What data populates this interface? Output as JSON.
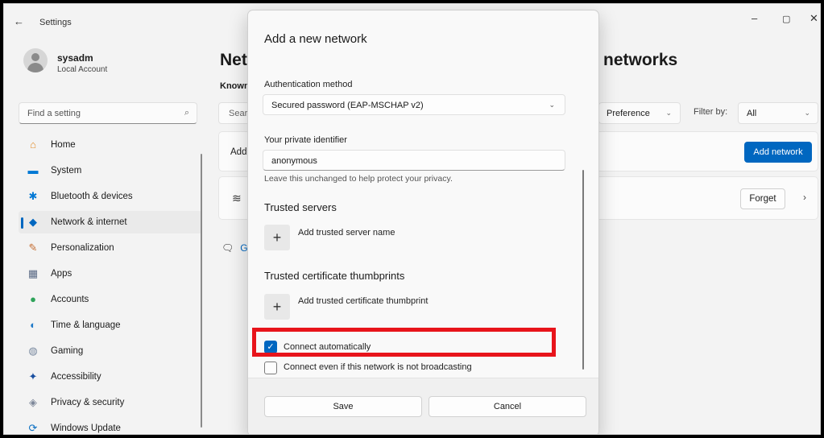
{
  "window": {
    "back": "←",
    "title": "Settings",
    "minimize": "–",
    "maximize": "▢",
    "close": "✕"
  },
  "profile": {
    "name": "sysadm",
    "type": "Local Account"
  },
  "sidebar": {
    "search_placeholder": "Find a setting",
    "items": [
      {
        "label": "Home",
        "icon": "⌂",
        "color": "#e28d2b"
      },
      {
        "label": "System",
        "icon": "▬",
        "color": "#0078d4"
      },
      {
        "label": "Bluetooth & devices",
        "icon": "✱",
        "color": "#0078d4"
      },
      {
        "label": "Network & internet",
        "icon": "◆",
        "color": "#0067c0",
        "active": true
      },
      {
        "label": "Personalization",
        "icon": "✎",
        "color": "#c36a2d"
      },
      {
        "label": "Apps",
        "icon": "▦",
        "color": "#5a6a85"
      },
      {
        "label": "Accounts",
        "icon": "●",
        "color": "#2ea35a"
      },
      {
        "label": "Time & language",
        "icon": "◐",
        "color": "#1f7ac8"
      },
      {
        "label": "Gaming",
        "icon": "◍",
        "color": "#7a8aa0"
      },
      {
        "label": "Accessibility",
        "icon": "✦",
        "color": "#1a4fa0"
      },
      {
        "label": "Privacy & security",
        "icon": "◈",
        "color": "#7d8799"
      },
      {
        "label": "Windows Update",
        "icon": "⟳",
        "color": "#0a6fc2"
      }
    ]
  },
  "main": {
    "title_left": "Net",
    "title_right": "networks",
    "known_label": "Known",
    "search_partial": "Sear",
    "sort_value": "Preference",
    "filter_label": "Filter by:",
    "filter_value": "All",
    "add_row_partial": "Add",
    "add_network_button": "Add network",
    "forget_button": "Forget",
    "get_help_partial": "G"
  },
  "dialog": {
    "title": "Add a new network",
    "auth_label": "Authentication method",
    "auth_value": "Secured password (EAP-MSCHAP v2)",
    "identifier_label": "Your private identifier",
    "identifier_value": "anonymous",
    "identifier_hint": "Leave this unchanged to help protect your privacy.",
    "trusted_servers_heading": "Trusted servers",
    "add_server_label": "Add trusted server name",
    "thumbprints_heading": "Trusted certificate thumbprints",
    "add_thumbprint_label": "Add trusted certificate thumbprint",
    "connect_auto_label": "Connect automatically",
    "connect_auto_checked": true,
    "connect_hidden_label": "Connect even if this network is not broadcasting",
    "connect_hidden_checked": false,
    "save_button": "Save",
    "cancel_button": "Cancel"
  },
  "colors": {
    "accent": "#0067c0",
    "highlight": "#e8141b"
  }
}
